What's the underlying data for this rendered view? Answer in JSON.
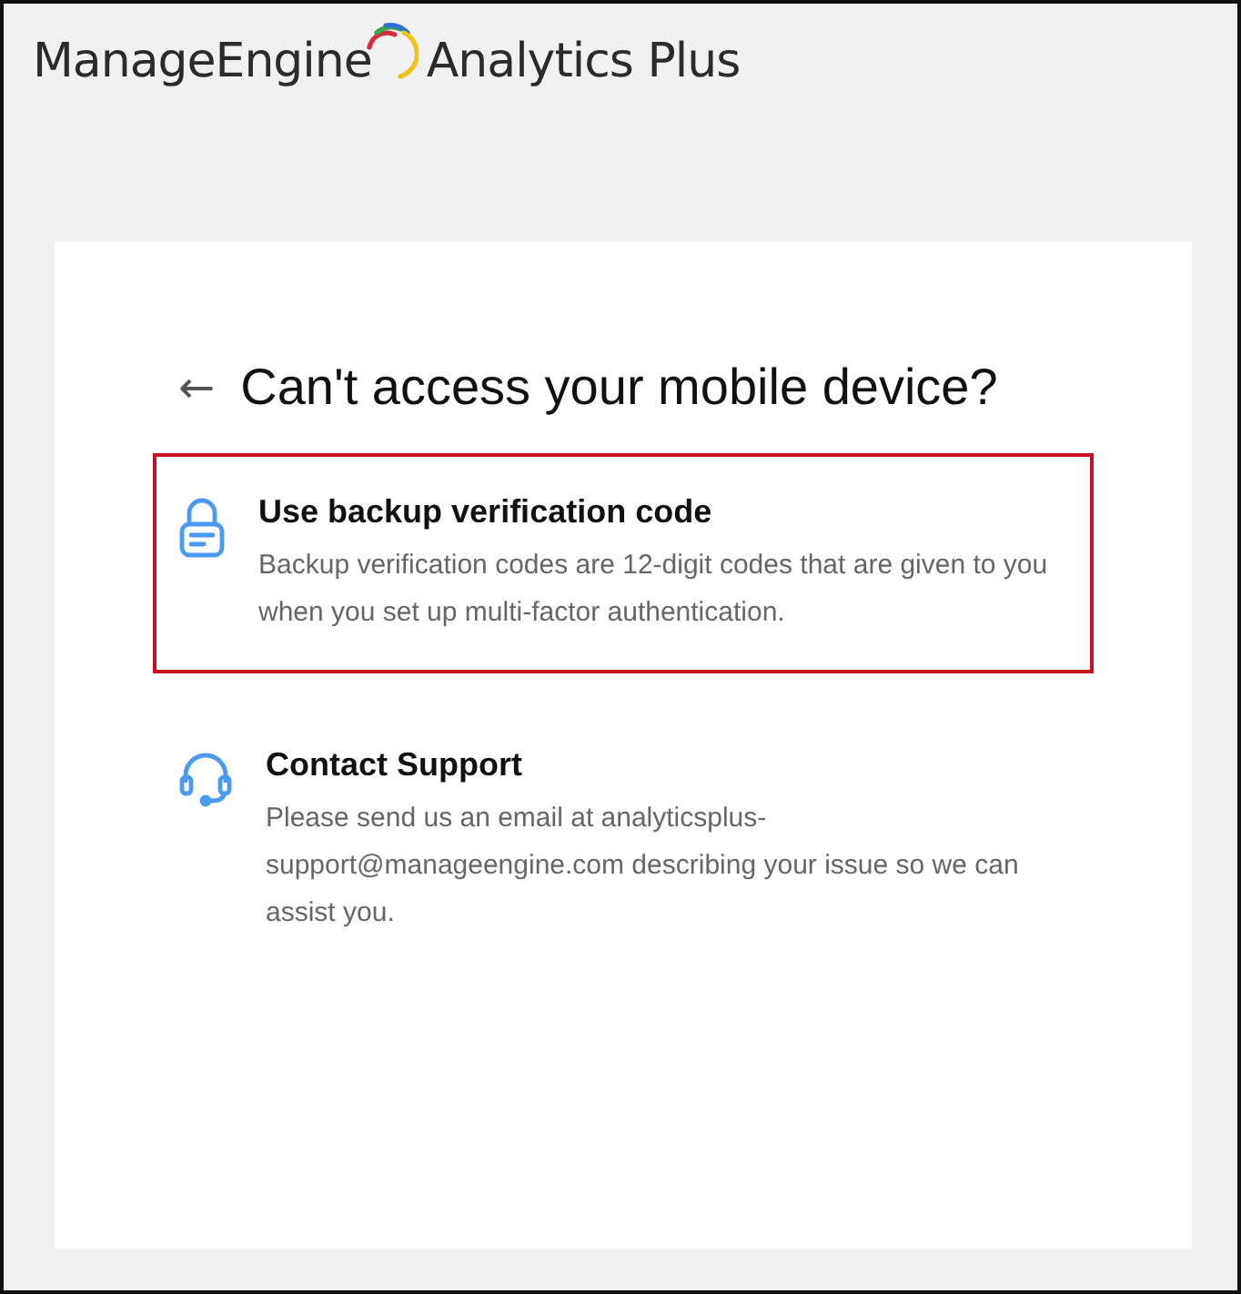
{
  "brand": {
    "company": "ManageEngine",
    "product": "Analytics Plus"
  },
  "heading": {
    "back": "←",
    "title": "Can't access your mobile device?"
  },
  "options": [
    {
      "kind": "lock",
      "title": "Use backup verification code",
      "description": "Backup verification codes are 12-digit codes that are given to you when you set up multi-factor authentication.",
      "highlighted": true
    },
    {
      "kind": "headset",
      "title": "Contact Support",
      "description": "Please send us an email at analyticsplus-support@manageengine.com describing your issue so we can assist you.",
      "highlighted": false
    }
  ]
}
